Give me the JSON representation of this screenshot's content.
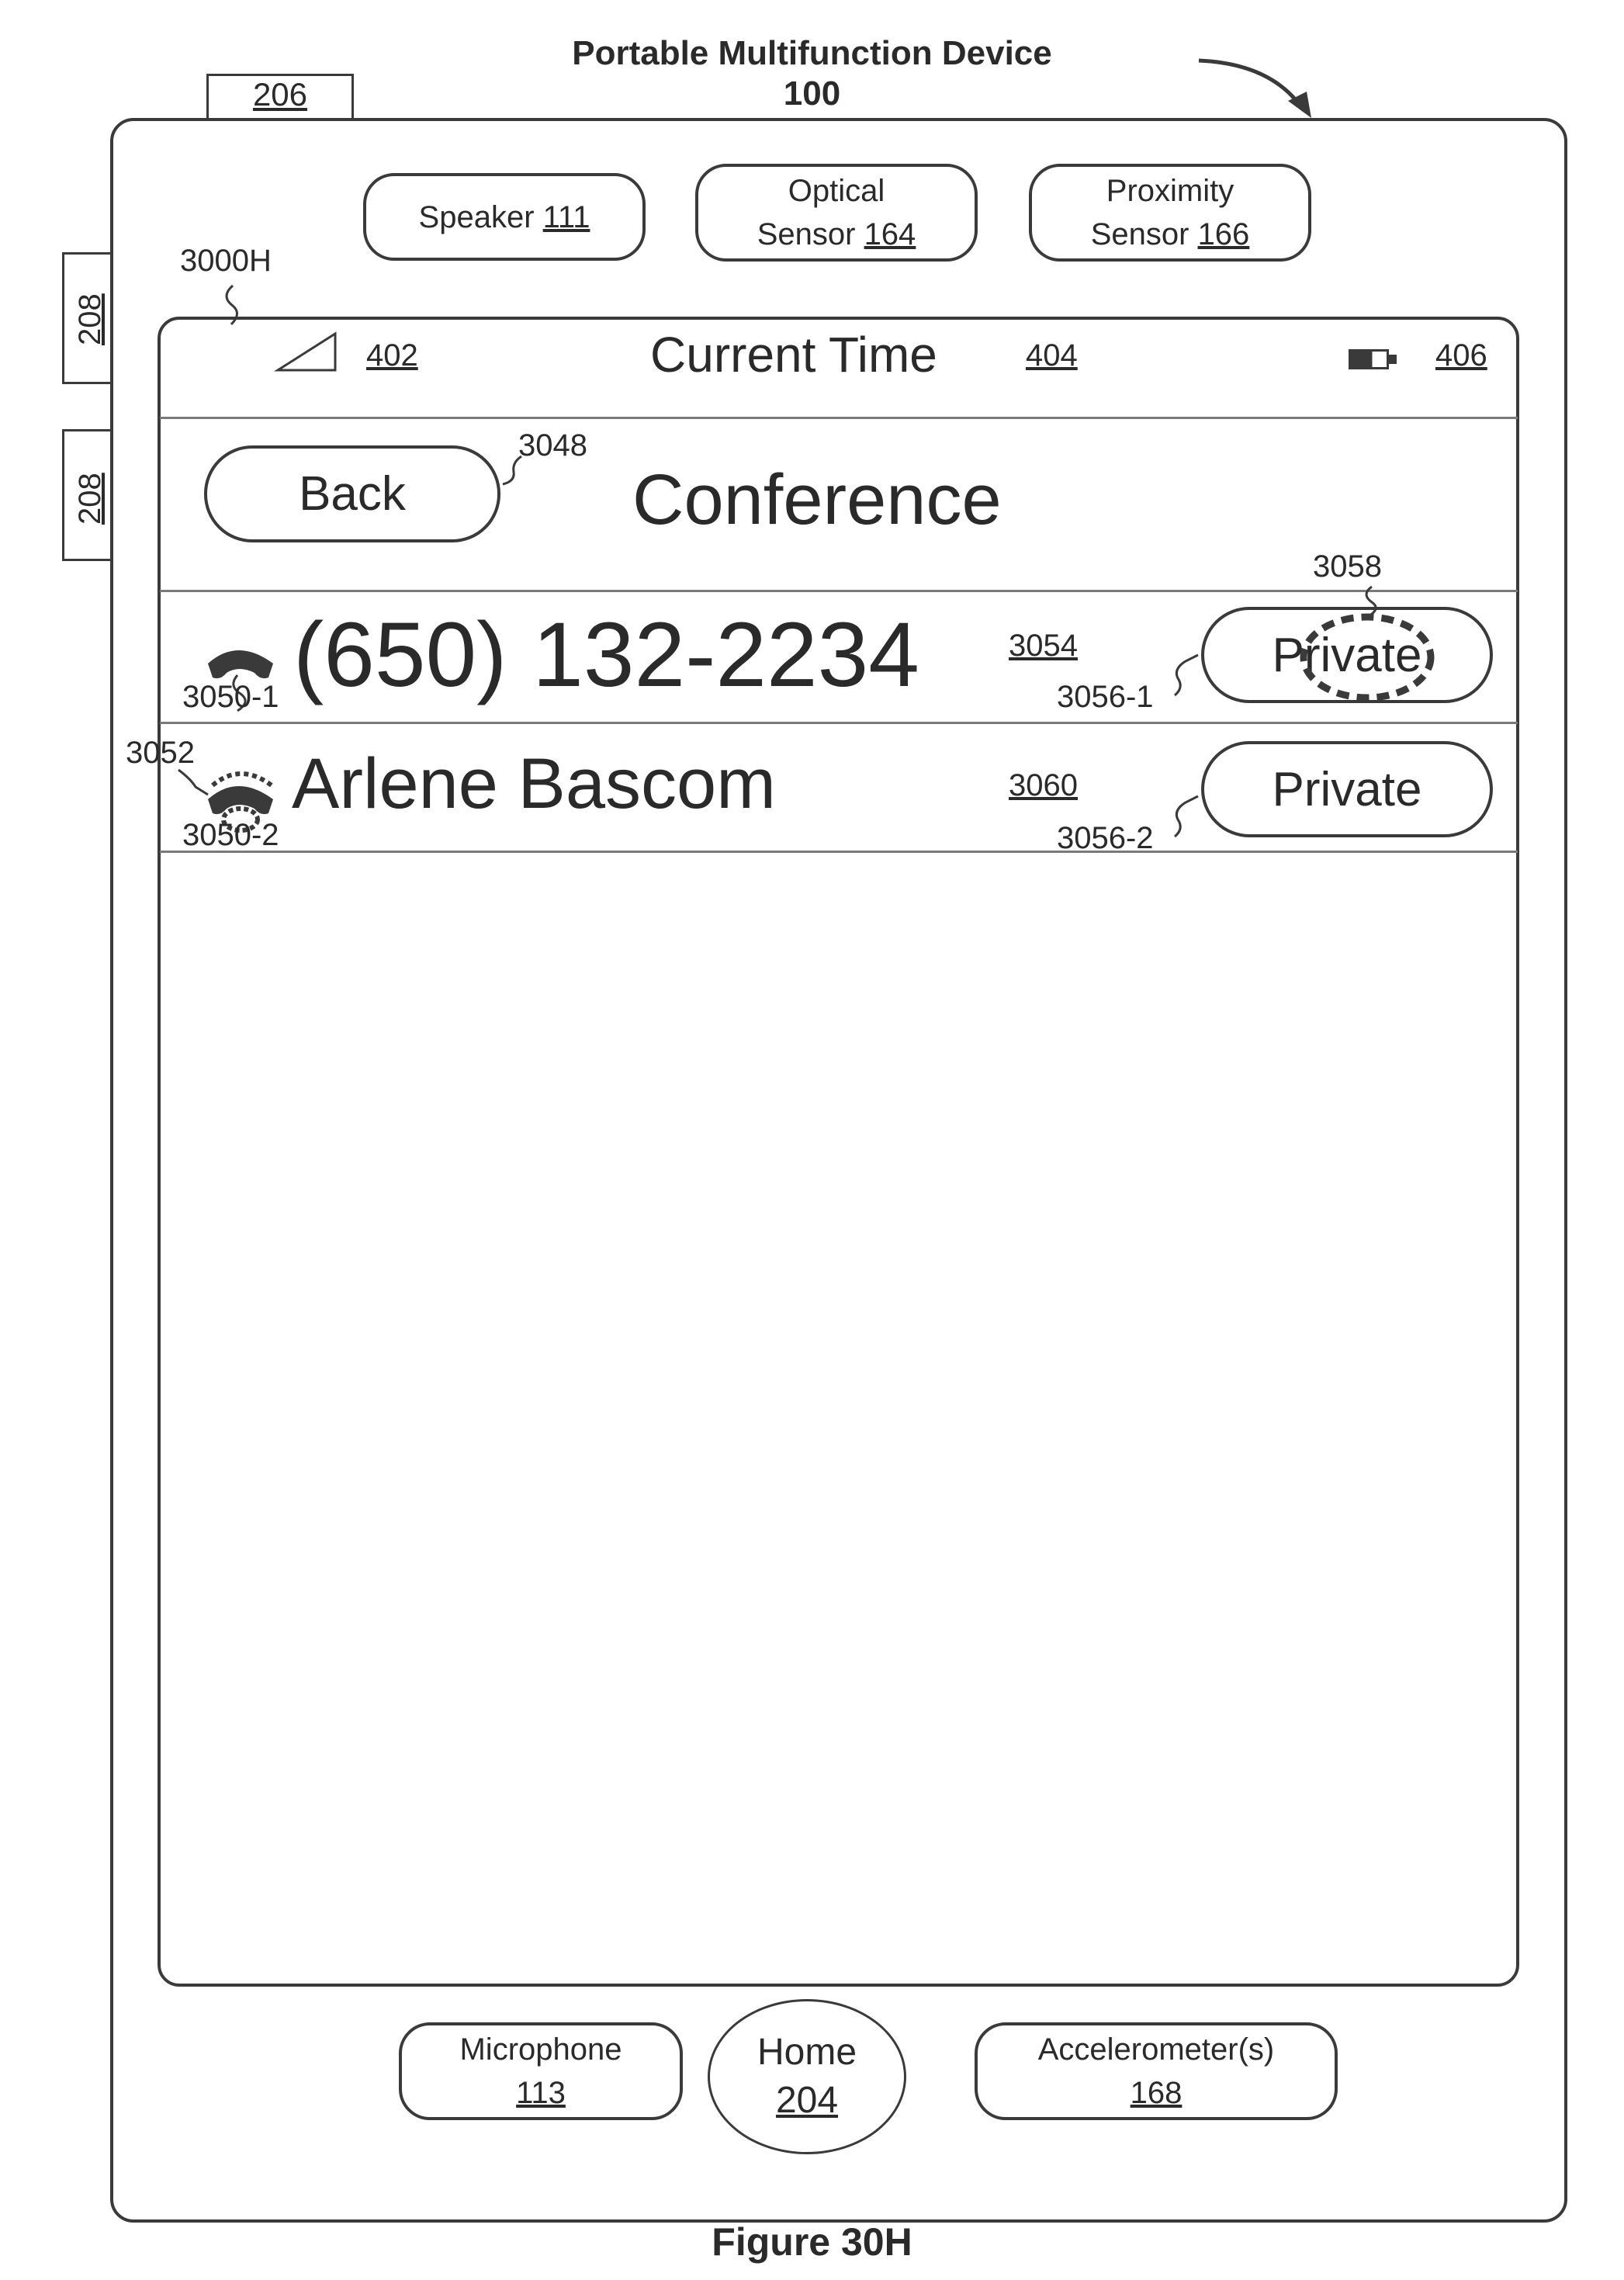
{
  "header": {
    "title": "Portable Multifunction Device",
    "number": "100"
  },
  "side_refs": {
    "top_button": "206",
    "volume_up": "208",
    "volume_down": "208"
  },
  "sensors": {
    "speaker_label": "Speaker",
    "speaker_ref": "111",
    "optical_line1": "Optical",
    "optical_line2": "Sensor",
    "optical_ref": "164",
    "proximity_line1": "Proximity",
    "proximity_line2": "Sensor",
    "proximity_ref": "166"
  },
  "screen_ref": "3000H",
  "status_bar": {
    "signal_ref": "402",
    "time_label": "Current Time",
    "time_ref": "404",
    "battery_ref": "406"
  },
  "nav": {
    "back_label": "Back",
    "back_ref": "3048",
    "title": "Conference"
  },
  "calls": [
    {
      "name": "(650) 132-2234",
      "name_ref": "3054",
      "icon_ref": "3050-1",
      "private_label": "Private",
      "private_ref": "3056-1",
      "touch_ref": "3058"
    },
    {
      "name": "Arlene Bascom",
      "name_ref": "3060",
      "icon_ref": "3050-2",
      "icon_anim_ref": "3052",
      "private_label": "Private",
      "private_ref": "3056-2"
    }
  ],
  "bottom": {
    "microphone_label": "Microphone",
    "microphone_ref": "113",
    "home_label": "Home",
    "home_ref": "204",
    "accel_label": "Accelerometer(s)",
    "accel_ref": "168"
  },
  "caption": "Figure 30H"
}
